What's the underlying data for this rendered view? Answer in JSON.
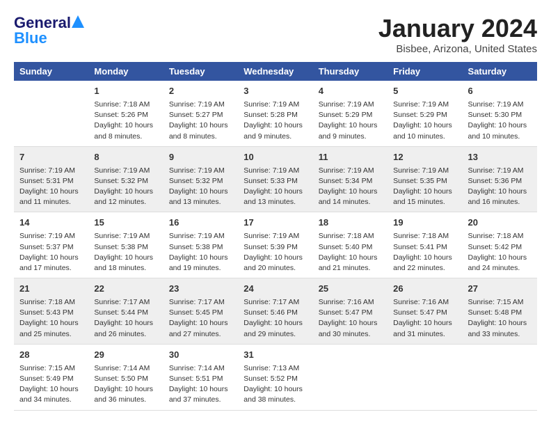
{
  "header": {
    "logo_general": "General",
    "logo_blue": "Blue",
    "title": "January 2024",
    "location": "Bisbee, Arizona, United States"
  },
  "columns": [
    "Sunday",
    "Monday",
    "Tuesday",
    "Wednesday",
    "Thursday",
    "Friday",
    "Saturday"
  ],
  "weeks": [
    [
      {
        "day": "",
        "info": ""
      },
      {
        "day": "1",
        "info": "Sunrise: 7:18 AM\nSunset: 5:26 PM\nDaylight: 10 hours\nand 8 minutes."
      },
      {
        "day": "2",
        "info": "Sunrise: 7:19 AM\nSunset: 5:27 PM\nDaylight: 10 hours\nand 8 minutes."
      },
      {
        "day": "3",
        "info": "Sunrise: 7:19 AM\nSunset: 5:28 PM\nDaylight: 10 hours\nand 9 minutes."
      },
      {
        "day": "4",
        "info": "Sunrise: 7:19 AM\nSunset: 5:29 PM\nDaylight: 10 hours\nand 9 minutes."
      },
      {
        "day": "5",
        "info": "Sunrise: 7:19 AM\nSunset: 5:29 PM\nDaylight: 10 hours\nand 10 minutes."
      },
      {
        "day": "6",
        "info": "Sunrise: 7:19 AM\nSunset: 5:30 PM\nDaylight: 10 hours\nand 10 minutes."
      }
    ],
    [
      {
        "day": "7",
        "info": "Sunrise: 7:19 AM\nSunset: 5:31 PM\nDaylight: 10 hours\nand 11 minutes."
      },
      {
        "day": "8",
        "info": "Sunrise: 7:19 AM\nSunset: 5:32 PM\nDaylight: 10 hours\nand 12 minutes."
      },
      {
        "day": "9",
        "info": "Sunrise: 7:19 AM\nSunset: 5:32 PM\nDaylight: 10 hours\nand 13 minutes."
      },
      {
        "day": "10",
        "info": "Sunrise: 7:19 AM\nSunset: 5:33 PM\nDaylight: 10 hours\nand 13 minutes."
      },
      {
        "day": "11",
        "info": "Sunrise: 7:19 AM\nSunset: 5:34 PM\nDaylight: 10 hours\nand 14 minutes."
      },
      {
        "day": "12",
        "info": "Sunrise: 7:19 AM\nSunset: 5:35 PM\nDaylight: 10 hours\nand 15 minutes."
      },
      {
        "day": "13",
        "info": "Sunrise: 7:19 AM\nSunset: 5:36 PM\nDaylight: 10 hours\nand 16 minutes."
      }
    ],
    [
      {
        "day": "14",
        "info": "Sunrise: 7:19 AM\nSunset: 5:37 PM\nDaylight: 10 hours\nand 17 minutes."
      },
      {
        "day": "15",
        "info": "Sunrise: 7:19 AM\nSunset: 5:38 PM\nDaylight: 10 hours\nand 18 minutes."
      },
      {
        "day": "16",
        "info": "Sunrise: 7:19 AM\nSunset: 5:38 PM\nDaylight: 10 hours\nand 19 minutes."
      },
      {
        "day": "17",
        "info": "Sunrise: 7:19 AM\nSunset: 5:39 PM\nDaylight: 10 hours\nand 20 minutes."
      },
      {
        "day": "18",
        "info": "Sunrise: 7:18 AM\nSunset: 5:40 PM\nDaylight: 10 hours\nand 21 minutes."
      },
      {
        "day": "19",
        "info": "Sunrise: 7:18 AM\nSunset: 5:41 PM\nDaylight: 10 hours\nand 22 minutes."
      },
      {
        "day": "20",
        "info": "Sunrise: 7:18 AM\nSunset: 5:42 PM\nDaylight: 10 hours\nand 24 minutes."
      }
    ],
    [
      {
        "day": "21",
        "info": "Sunrise: 7:18 AM\nSunset: 5:43 PM\nDaylight: 10 hours\nand 25 minutes."
      },
      {
        "day": "22",
        "info": "Sunrise: 7:17 AM\nSunset: 5:44 PM\nDaylight: 10 hours\nand 26 minutes."
      },
      {
        "day": "23",
        "info": "Sunrise: 7:17 AM\nSunset: 5:45 PM\nDaylight: 10 hours\nand 27 minutes."
      },
      {
        "day": "24",
        "info": "Sunrise: 7:17 AM\nSunset: 5:46 PM\nDaylight: 10 hours\nand 29 minutes."
      },
      {
        "day": "25",
        "info": "Sunrise: 7:16 AM\nSunset: 5:47 PM\nDaylight: 10 hours\nand 30 minutes."
      },
      {
        "day": "26",
        "info": "Sunrise: 7:16 AM\nSunset: 5:47 PM\nDaylight: 10 hours\nand 31 minutes."
      },
      {
        "day": "27",
        "info": "Sunrise: 7:15 AM\nSunset: 5:48 PM\nDaylight: 10 hours\nand 33 minutes."
      }
    ],
    [
      {
        "day": "28",
        "info": "Sunrise: 7:15 AM\nSunset: 5:49 PM\nDaylight: 10 hours\nand 34 minutes."
      },
      {
        "day": "29",
        "info": "Sunrise: 7:14 AM\nSunset: 5:50 PM\nDaylight: 10 hours\nand 36 minutes."
      },
      {
        "day": "30",
        "info": "Sunrise: 7:14 AM\nSunset: 5:51 PM\nDaylight: 10 hours\nand 37 minutes."
      },
      {
        "day": "31",
        "info": "Sunrise: 7:13 AM\nSunset: 5:52 PM\nDaylight: 10 hours\nand 38 minutes."
      },
      {
        "day": "",
        "info": ""
      },
      {
        "day": "",
        "info": ""
      },
      {
        "day": "",
        "info": ""
      }
    ]
  ]
}
